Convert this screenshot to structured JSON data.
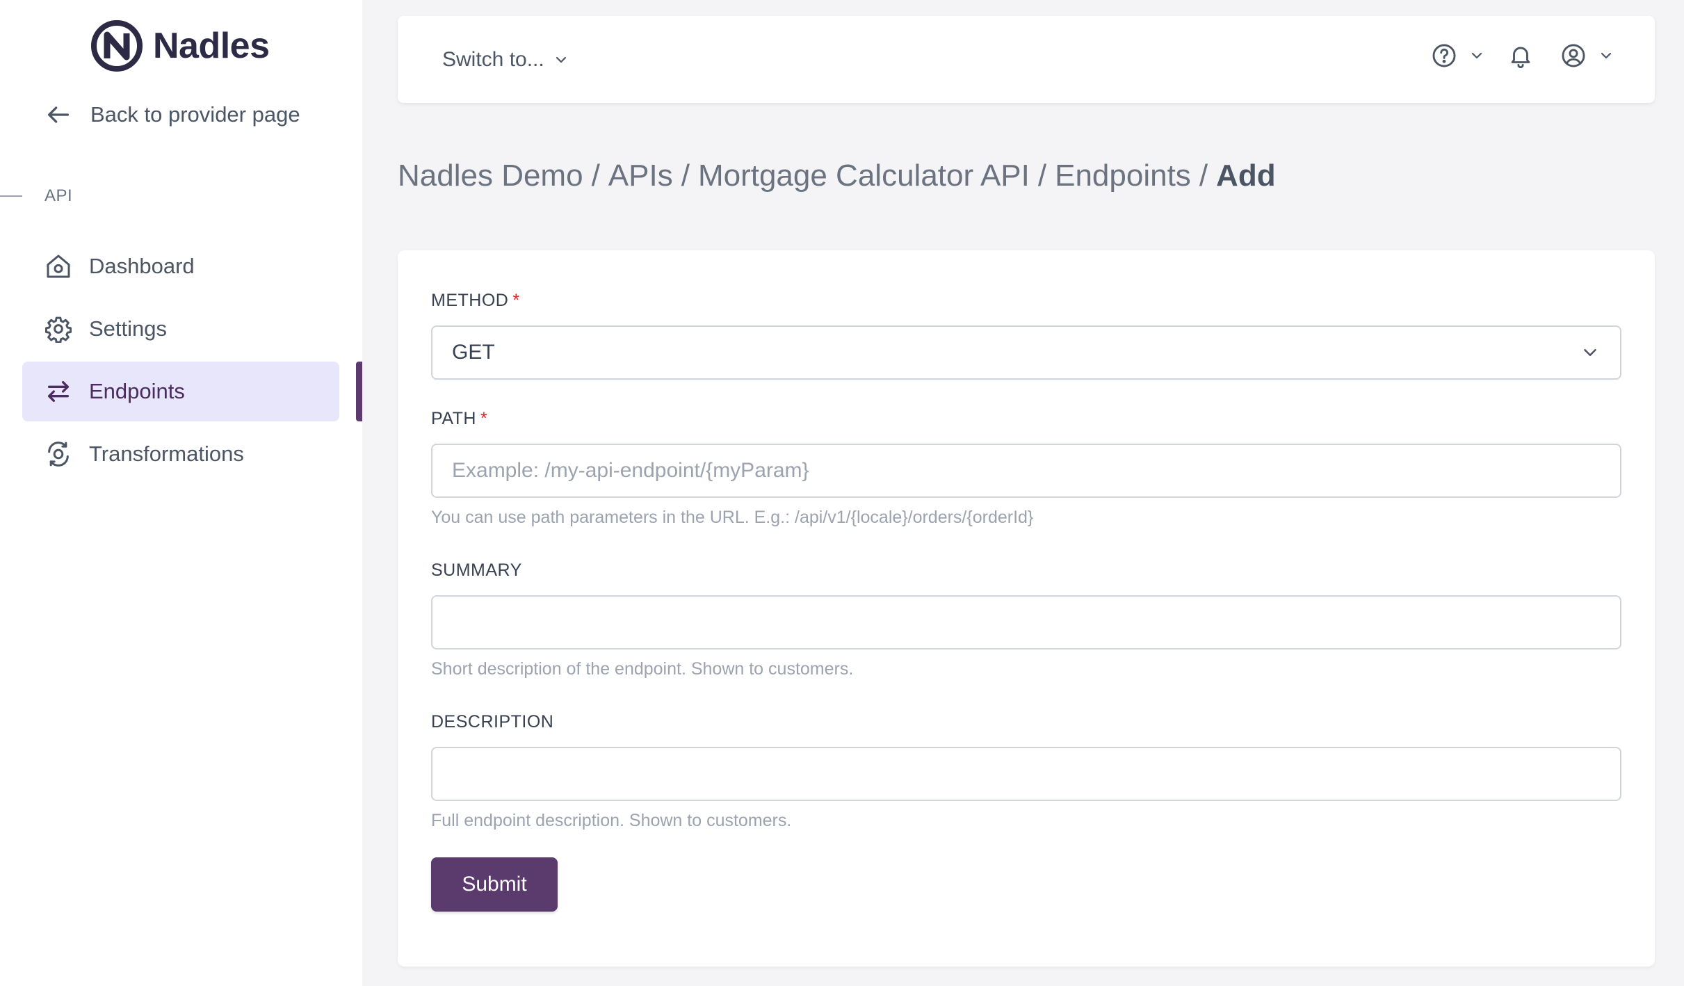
{
  "brand": {
    "name": "Nadles",
    "accent": "#5b3a6e",
    "logo_icon": "nadles-logo-icon"
  },
  "sidebar": {
    "back_label": "Back to provider page",
    "section_label": "API",
    "items": [
      {
        "label": "Dashboard",
        "icon": "home-icon",
        "active": false
      },
      {
        "label": "Settings",
        "icon": "gear-icon",
        "active": false
      },
      {
        "label": "Endpoints",
        "icon": "arrows-swap-icon",
        "active": true
      },
      {
        "label": "Transformations",
        "icon": "transform-icon",
        "active": false
      }
    ]
  },
  "topbar": {
    "switch_label": "Switch to...",
    "icons": [
      "help-icon",
      "bell-icon",
      "user-icon"
    ]
  },
  "breadcrumb": {
    "items": [
      "Nadles Demo",
      "APIs",
      "Mortgage Calculator API",
      "Endpoints"
    ],
    "separator": "/",
    "current": "Add"
  },
  "form": {
    "method": {
      "label": "METHOD",
      "required_marker": "*",
      "value": "GET"
    },
    "path": {
      "label": "PATH",
      "required_marker": "*",
      "value": "",
      "placeholder": "Example: /my-api-endpoint/{myParam}",
      "help": "You can use path parameters in the URL. E.g.: /api/v1/{locale}/orders/{orderId}"
    },
    "summary": {
      "label": "SUMMARY",
      "value": "",
      "help": "Short description of the endpoint. Shown to customers."
    },
    "description": {
      "label": "DESCRIPTION",
      "value": "",
      "help": "Full endpoint description. Shown to customers."
    },
    "submit_label": "Submit"
  }
}
